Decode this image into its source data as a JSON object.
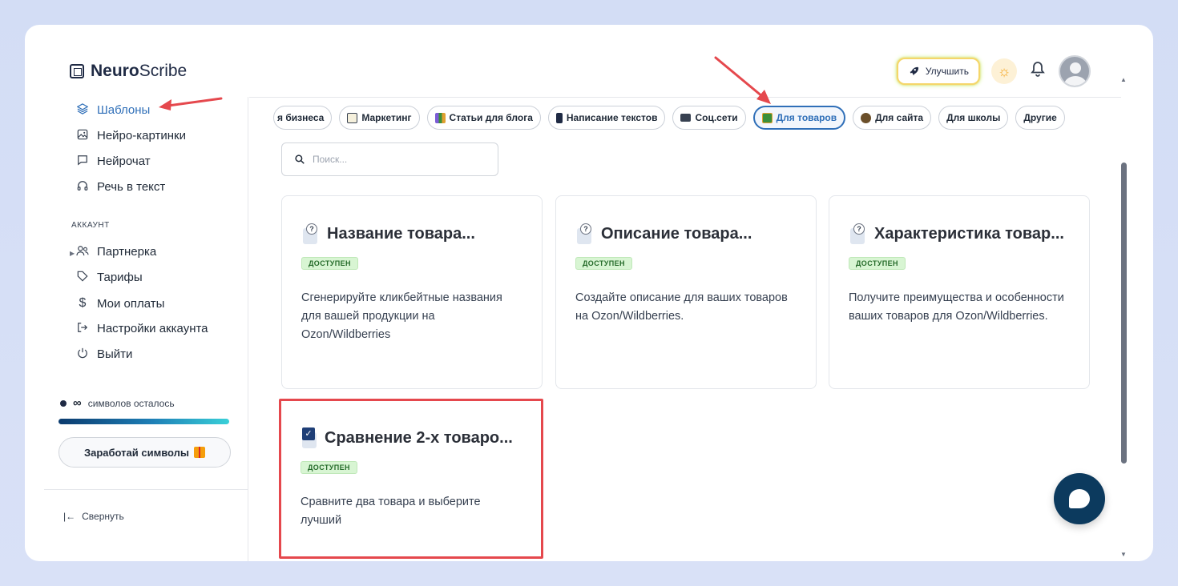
{
  "app": {
    "logo_bold": "Neuro",
    "logo_rest": "Scribe"
  },
  "header": {
    "upgrade_label": "Улучшить",
    "sun_icon": "sun-icon",
    "bell_icon": "bell-icon"
  },
  "sidebar": {
    "items": [
      {
        "label": "Шаблоны",
        "icon": "layers-icon",
        "active": true
      },
      {
        "label": "Нейро-картинки",
        "icon": "image-icon"
      },
      {
        "label": "Нейрочат",
        "icon": "chat-icon"
      },
      {
        "label": "Речь в текст",
        "icon": "headphones-icon"
      }
    ],
    "account_label": "АККАУНТ",
    "account_items": [
      {
        "label": "Партнерка",
        "icon": "users-icon"
      },
      {
        "label": "Тарифы",
        "icon": "tag-icon"
      },
      {
        "label": "Мои оплаты",
        "icon": "dollar-icon"
      },
      {
        "label": "Настройки аккаунта",
        "icon": "login-icon"
      },
      {
        "label": "Выйти",
        "icon": "power-icon"
      }
    ],
    "symbols_value": "∞",
    "symbols_label": "символов осталось",
    "symbols_progress": 1.0,
    "earn_label": "Заработай символы",
    "collapse_label": "Свернуть"
  },
  "categories": [
    {
      "label": "я бизнеса",
      "icon": ""
    },
    {
      "label": "Маркетинг",
      "icon": "memo-icon",
      "color": "#6b7280"
    },
    {
      "label": "Статьи для блога",
      "icon": "books-icon",
      "color": "#7c5cd6"
    },
    {
      "label": "Написание текстов",
      "icon": "phone-icon",
      "color": "#1f2a44"
    },
    {
      "label": "Соц.сети",
      "icon": "laptop-icon",
      "color": "#374151"
    },
    {
      "label": "Для товаров",
      "icon": "ledger-icon",
      "color": "#3a8f3a",
      "active": true
    },
    {
      "label": "Для сайта",
      "icon": "robot-icon",
      "color": "#6b4f2a"
    },
    {
      "label": "Для школы",
      "icon": ""
    },
    {
      "label": "Другие",
      "icon": ""
    }
  ],
  "search": {
    "placeholder": "Поиск..."
  },
  "cards": [
    {
      "title": "Название товара...",
      "badge": "ДОСТУПЕН",
      "desc": "Сгенерируйте кликбейтные названия для вашей продукции на Ozon/Wildberries",
      "icon": "question-doc-icon"
    },
    {
      "title": "Описание товара...",
      "badge": "ДОСТУПЕН",
      "desc": "Создайте описание для ваших товаров на Ozon/Wildberries.",
      "icon": "question-doc-icon"
    },
    {
      "title": "Характеристика товар...",
      "badge": "ДОСТУПЕН",
      "desc": "Получите преимущества и особенности ваших товаров для Ozon/Wildberries.",
      "icon": "question-doc-icon"
    },
    {
      "title": "Сравнение 2-х товаро...",
      "badge": "ДОСТУПЕН",
      "desc": "Сравните два товара и выберите лучший",
      "icon": "checkbox-doc-icon"
    }
  ],
  "colors": {
    "accent": "#2f6fb8",
    "highlight": "#e5484d",
    "badge_bg": "#d8f5d3",
    "chat": "#0c3a5e"
  }
}
